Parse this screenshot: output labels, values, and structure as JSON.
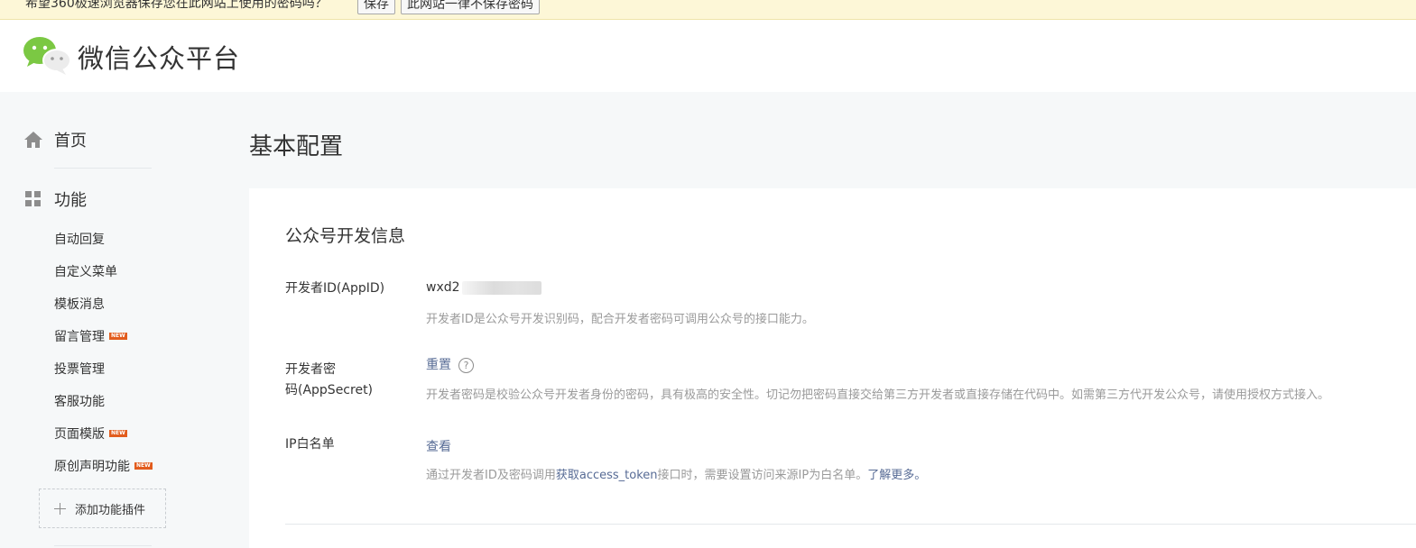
{
  "password_bar": {
    "message": "希望360极速浏览器保存您在此网站上使用的密码吗？",
    "save_button": "保存",
    "never_button": "此网站一律不保存密码"
  },
  "header": {
    "logo_text": "微信公众平台",
    "logo_icon": "wechat-logo-icon"
  },
  "sidebar": {
    "home": {
      "label": "首页",
      "icon": "home-icon"
    },
    "features": {
      "label": "功能",
      "icon": "grid-icon"
    },
    "items": [
      {
        "label": "自动回复",
        "new": false
      },
      {
        "label": "自定义菜单",
        "new": false
      },
      {
        "label": "模板消息",
        "new": false
      },
      {
        "label": "留言管理",
        "new": true
      },
      {
        "label": "投票管理",
        "new": false
      },
      {
        "label": "客服功能",
        "new": false
      },
      {
        "label": "页面模版",
        "new": true
      },
      {
        "label": "原创声明功能",
        "new": true
      }
    ],
    "new_badge": "NEW",
    "add_plugin": "添加功能插件"
  },
  "main": {
    "page_title": "基本配置",
    "section_title": "公众号开发信息",
    "appid": {
      "label": "开发者ID(AppID)",
      "value": "wxd2",
      "desc": "开发者ID是公众号开发识别码，配合开发者密码可调用公众号的接口能力。"
    },
    "appsecret": {
      "label_line1": "开发者密",
      "label_line2": "码(AppSecret)",
      "reset_link": "重置",
      "help": "?",
      "desc": "开发者密码是校验公众号开发者身份的密码，具有极高的安全性。切记勿把密码直接交给第三方开发者或直接存储在代码中。如需第三方代开发公众号，请使用授权方式接入。"
    },
    "ip_whitelist": {
      "label": "IP白名单",
      "view_link": "查看",
      "desc_prefix": "通过开发者ID及密码调用",
      "desc_link": "获取access_token",
      "desc_middle": "接口时，需要设置访问来源IP为白名单。",
      "learn_more": "了解更多。"
    }
  },
  "colors": {
    "link": "#576b95",
    "new_badge": "#e25c1d",
    "wechat_green": "#7bc843",
    "background": "#f6f8f9"
  }
}
